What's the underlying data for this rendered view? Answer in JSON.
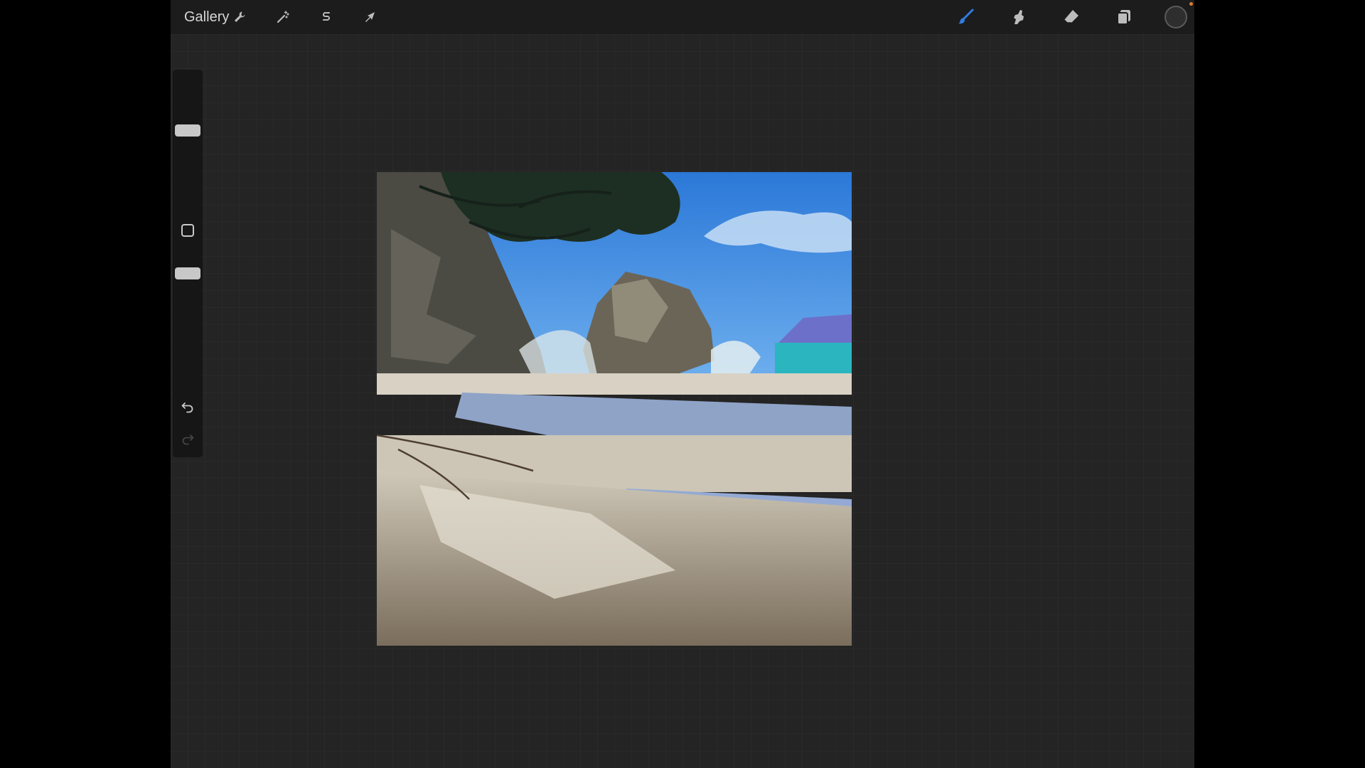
{
  "topbar": {
    "gallery_label": "Gallery",
    "left_tools": [
      {
        "name": "actions",
        "icon": "wrench-icon"
      },
      {
        "name": "adjustments",
        "icon": "magic-wand-icon"
      },
      {
        "name": "selection",
        "icon": "selection-s-icon"
      },
      {
        "name": "transform",
        "icon": "arrow-cursor-icon"
      }
    ],
    "right_tools": [
      {
        "name": "brush",
        "icon": "brush-icon",
        "active": true,
        "active_color": "#2f7de1"
      },
      {
        "name": "smudge",
        "icon": "smudge-finger-icon"
      },
      {
        "name": "eraser",
        "icon": "eraser-icon"
      },
      {
        "name": "layers",
        "icon": "layers-icon"
      }
    ],
    "current_color": "#2e2e2e"
  },
  "sidebar": {
    "brush_size_level": 0.55,
    "brush_opacity_level": 0.85,
    "modify_button_icon": "square-icon",
    "undo_icon": "undo-arrow-icon",
    "redo_icon": "redo-arrow-icon",
    "redo_enabled": false
  },
  "canvas": {
    "content": "painting-beach-rock-scene",
    "colors": {
      "sky": "#3f8ee6",
      "sea": "#2bb6bf",
      "sand": "#d9d3c5",
      "shadow_sand": "#7d705f",
      "rock": "#5e5a4f",
      "foliage": "#1f3a24"
    }
  }
}
